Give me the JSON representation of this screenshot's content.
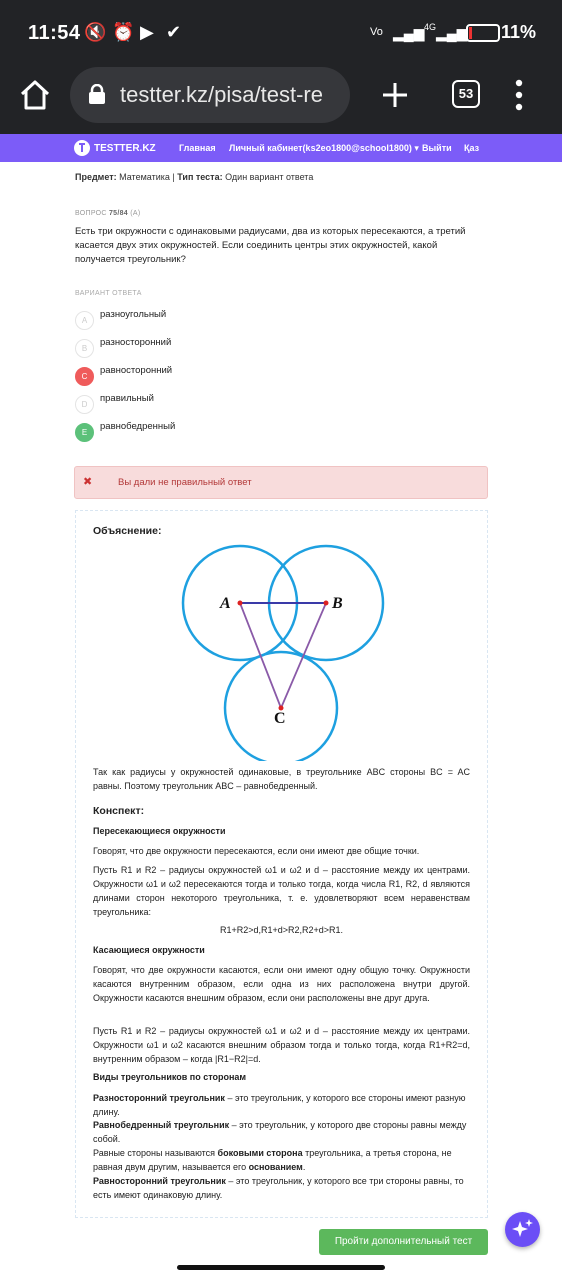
{
  "status_bar": {
    "time": "11:54",
    "battery": "11%",
    "network": "4G"
  },
  "browser": {
    "url": "testter.kz/pisa/test-re",
    "tab_count": "53"
  },
  "nav": {
    "brand": "TESTTER.KZ",
    "items": [
      "Главная",
      "Личный кабинет(ks2eo1800@school1800) ▾",
      "Выйти",
      "Қаз"
    ]
  },
  "meta": {
    "subject_label": "Предмет:",
    "subject": "Математика",
    "sep": "|",
    "type_label": "Тип теста:",
    "type": "Один вариант ответа"
  },
  "question": {
    "number_label": "ВОПРОС",
    "number": "75/84",
    "variant": "(А)",
    "text": "Есть три окружности с одинаковыми радиусами, два из которых пересекаются, а третий касается двух этих окружностей. Если соединить центры этих окружностей, какой получается треугольник?"
  },
  "answers_label": "ВАРИАНТ ОТВЕТА",
  "options": [
    {
      "letter": "A",
      "text": "разноугольный",
      "state": "none"
    },
    {
      "letter": "B",
      "text": "разносторонний",
      "state": "none"
    },
    {
      "letter": "C",
      "text": "равносторонний",
      "state": "wrong"
    },
    {
      "letter": "D",
      "text": "правильный",
      "state": "none"
    },
    {
      "letter": "E",
      "text": "равнобедренный",
      "state": "correct"
    }
  ],
  "alert": {
    "icon": "✖",
    "text": "Вы дали не правильный ответ"
  },
  "explanation": {
    "title": "Объяснение:",
    "diagram_labels": {
      "a": "A",
      "b": "B",
      "c": "C"
    },
    "text": "Так как радиусы у окружностей одинаковые, в треугольнике ABC стороны BC = AC равны. Поэтому треугольник ABC – равнобедренный.",
    "konspekt_title": "Конспект:",
    "h_intersect": "Пересекающиеся окружности",
    "p_intersect_1": "Говорят, что две окружности пересекаются, если они имеют две общие точки.",
    "p_intersect_2": "Пусть R1 и R2 – радиусы окружностей ω1 и ω2 и d – расстояние между их центрами. Окружности ω1 и ω2 пересекаются тогда и только тогда, когда числа R1, R2, d являются длинами сторон некоторого треугольника, т. е. удовлетворяют всем неравенствам треугольника:",
    "formula": "R1+R2>d,R1+d>R2,R2+d>R1.",
    "h_tangent": "Касающиеся окружности",
    "p_tangent_1": "Говорят, что две окружности касаются, если они имеют одну общую точку. Окружности касаются внутренним образом, если одна из них расположена внутри другой. Окружности касаются внешним образом, если они расположены вне друг друга.",
    "p_tangent_2": "Пусть R1 и R2 – радиусы окружностей ω1 и ω2 и d – расстояние между их центрами. Окружности ω1 и ω2 касаются внешним образом тогда и только тогда, когда R1+R2=d, внутренним образом – когда |R1−R2|=d.",
    "h_types": "Виды треугольников по сторонам",
    "t1_bold": "Разносторонний треугольник",
    "t1_rest": " – это треугольник, у которого все стороны имеют разную длину.",
    "t2_bold": "Равнобедренный треугольник",
    "t2_rest": " – это треугольник, у которого две стороны равны между собой.",
    "t3_a": "Равные стороны называются ",
    "t3_b": "боковыми сторона",
    "t3_c": " треугольника, а третья сторона, не равная двум другим, называется его ",
    "t3_d": "основанием",
    "t3_e": ".",
    "t4_bold": "Равносторонний треугольник",
    "t4_rest": " – это треугольник, у которого все три стороны равны, то есть имеют одинаковую длину."
  },
  "button_more": "Пройти дополнительный тест",
  "colors": {
    "nav": "#7c5cf8",
    "wrong": "#ef5b5b",
    "correct": "#5cc17a",
    "circle": "#1ea0e0",
    "button": "#5cb85c"
  }
}
